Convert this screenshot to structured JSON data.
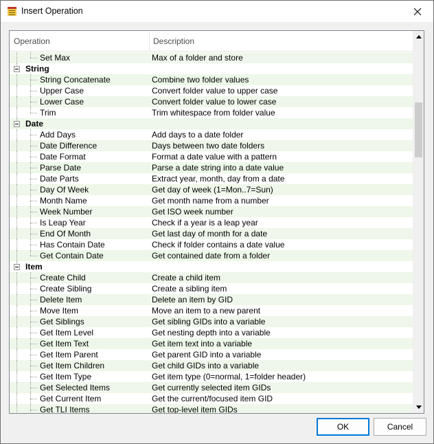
{
  "window": {
    "title": "Insert Operation"
  },
  "columns": {
    "operation": "Operation",
    "description": "Description"
  },
  "rows": [
    {
      "type": "item",
      "name": "Set Max",
      "desc": "Max of a folder and store",
      "last": true
    },
    {
      "type": "category",
      "name": "String"
    },
    {
      "type": "item",
      "name": "String Concatenate",
      "desc": "Combine two folder values"
    },
    {
      "type": "item",
      "name": "Upper Case",
      "desc": "Convert folder value to upper case"
    },
    {
      "type": "item",
      "name": "Lower Case",
      "desc": "Convert folder value to lower case"
    },
    {
      "type": "item",
      "name": "Trim",
      "desc": "Trim whitespace from folder value",
      "last": true
    },
    {
      "type": "category",
      "name": "Date"
    },
    {
      "type": "item",
      "name": "Add Days",
      "desc": "Add days to a date folder"
    },
    {
      "type": "item",
      "name": "Date Difference",
      "desc": "Days between two date folders"
    },
    {
      "type": "item",
      "name": "Date Format",
      "desc": "Format a date value with a pattern"
    },
    {
      "type": "item",
      "name": "Parse Date",
      "desc": "Parse a date string into a date value"
    },
    {
      "type": "item",
      "name": "Date Parts",
      "desc": "Extract year, month, day from a date"
    },
    {
      "type": "item",
      "name": "Day Of Week",
      "desc": "Get day of week (1=Mon..7=Sun)"
    },
    {
      "type": "item",
      "name": "Month Name",
      "desc": "Get month name from a number"
    },
    {
      "type": "item",
      "name": "Week Number",
      "desc": "Get ISO week number"
    },
    {
      "type": "item",
      "name": "Is Leap Year",
      "desc": "Check if a year is a leap year"
    },
    {
      "type": "item",
      "name": "End Of Month",
      "desc": "Get last day of month for a date"
    },
    {
      "type": "item",
      "name": "Has Contain Date",
      "desc": "Check if folder contains a date value"
    },
    {
      "type": "item",
      "name": "Get Contain Date",
      "desc": "Get contained date from a folder",
      "last": true
    },
    {
      "type": "category",
      "name": "Item"
    },
    {
      "type": "item",
      "name": "Create Child",
      "desc": "Create a child item"
    },
    {
      "type": "item",
      "name": "Create Sibling",
      "desc": "Create a sibling item"
    },
    {
      "type": "item",
      "name": "Delete Item",
      "desc": "Delete an item by GID"
    },
    {
      "type": "item",
      "name": "Move Item",
      "desc": "Move an item to a new parent"
    },
    {
      "type": "item",
      "name": "Get Siblings",
      "desc": "Get sibling GIDs into a variable"
    },
    {
      "type": "item",
      "name": "Get Item Level",
      "desc": "Get nesting depth into a variable"
    },
    {
      "type": "item",
      "name": "Get Item Text",
      "desc": "Get item text into a variable"
    },
    {
      "type": "item",
      "name": "Get Item Parent",
      "desc": "Get parent GID into a variable"
    },
    {
      "type": "item",
      "name": "Get Item Children",
      "desc": "Get child GIDs into a variable"
    },
    {
      "type": "item",
      "name": "Get Item Type",
      "desc": "Get item type (0=normal, 1=folder header)"
    },
    {
      "type": "item",
      "name": "Get Selected Items",
      "desc": "Get currently selected item GIDs"
    },
    {
      "type": "item",
      "name": "Get Current Item",
      "desc": "Get the current/focused item GID"
    },
    {
      "type": "item",
      "name": "Get TLI Items",
      "desc": "Get top-level item GIDs"
    }
  ],
  "buttons": {
    "ok": "OK",
    "cancel": "Cancel"
  },
  "colors": {
    "alt_row": "#eef7e9",
    "default_button_border": "#0078d7"
  },
  "icons": {
    "title": "app-icon",
    "close": "close-icon",
    "expand": "collapse-minus-icon"
  }
}
